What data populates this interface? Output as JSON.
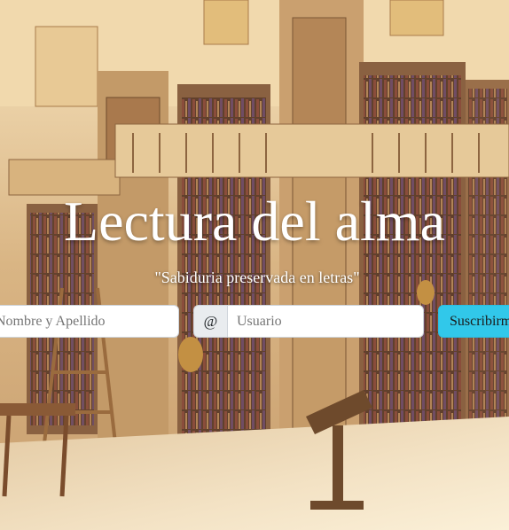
{
  "hero": {
    "title": "Lectura del alma",
    "subtitle": "\"Sabiduria preservada en letras\""
  },
  "form": {
    "name_placeholder": "Nombre y Apellido",
    "at_symbol": "@",
    "user_placeholder": "Usuario",
    "submit_label": "Suscribirme"
  }
}
